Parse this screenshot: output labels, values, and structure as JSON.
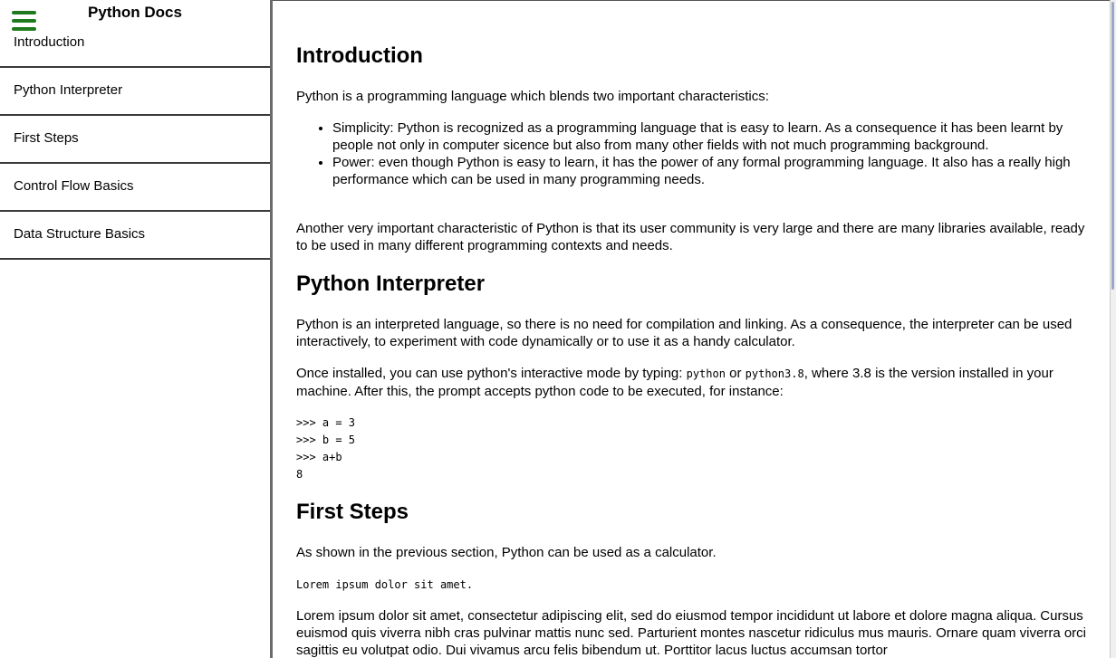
{
  "sidebar": {
    "title": "Python Docs",
    "menu_icon": "hamburger-menu-icon",
    "items": [
      {
        "label": "Introduction"
      },
      {
        "label": "Python Interpreter"
      },
      {
        "label": "First Steps"
      },
      {
        "label": "Control Flow Basics"
      },
      {
        "label": "Data Structure Basics"
      }
    ]
  },
  "colors": {
    "menu_icon": "#1f7a1f",
    "sidebar_border": "#6b6b6b"
  },
  "content": {
    "intro": {
      "heading": "Introduction",
      "p1": "Python is a programming language which blends two important characteristics:",
      "bullets": [
        "Simplicity: Python is recognized as a programming language that is easy to learn. As a consequence it has been learnt by people not only in computer sicence but also from many other fields with not much programming background.",
        "Power: even though Python is easy to learn, it has the power of any formal programming language. It also has a really high performance which can be used in many programming needs."
      ],
      "p2": "Another very important characteristic of Python is that its user community is very large and there are many libraries available, ready to be used in many different programming contexts and needs."
    },
    "interpreter": {
      "heading": "Python Interpreter",
      "p1": "Python is an interpreted language, so there is no need for compilation and linking. As a consequence, the interpreter can be used interactively, to experiment with code dynamically or to use it as a handy calculator.",
      "p2_start": "Once installed, you can use python's interactive mode by typing: ",
      "code1": "python",
      "p2_or": " or ",
      "code2": "python3.8",
      "p2_end": ", where 3.8 is the version installed in your machine. After this, the prompt accepts python code to be executed, for instance:",
      "code_lines": [
        ">>> a = 3",
        ">>> b = 5",
        ">>> a+b",
        "8"
      ]
    },
    "first_steps": {
      "heading": "First Steps",
      "p1": "As shown in the previous section, Python can be used as a calculator.",
      "code": "Lorem ipsum dolor sit amet.",
      "p2": "Lorem ipsum dolor sit amet, consectetur adipiscing elit, sed do eiusmod tempor incididunt ut labore et dolore magna aliqua. Cursus euismod quis viverra nibh cras pulvinar mattis nunc sed. Parturient montes nascetur ridiculus mus mauris. Ornare quam viverra orci sagittis eu volutpat odio. Dui vivamus arcu felis bibendum ut. Porttitor lacus luctus accumsan tortor"
    }
  }
}
